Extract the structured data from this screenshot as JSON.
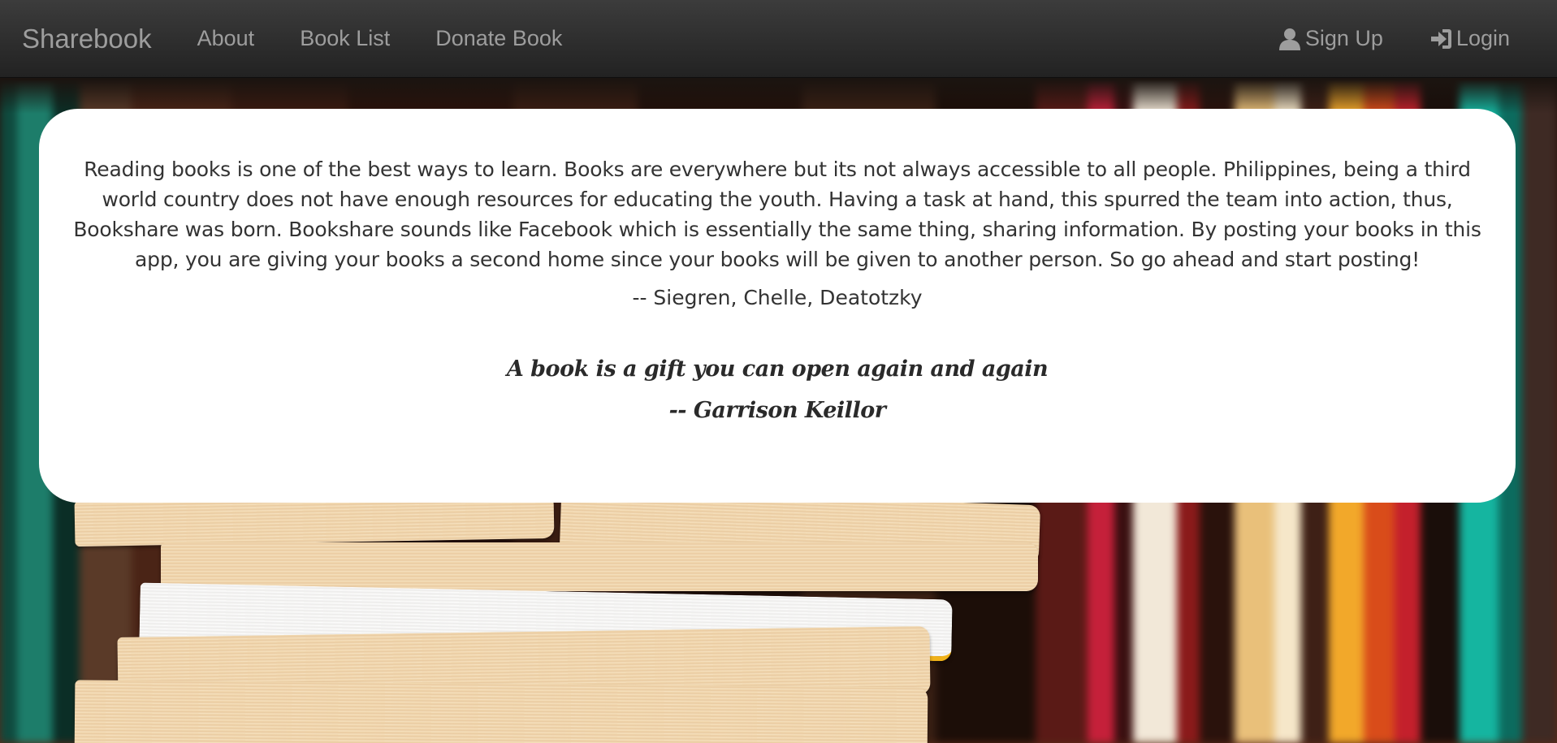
{
  "navbar": {
    "brand": "Sharebook",
    "links": [
      {
        "label": "About"
      },
      {
        "label": "Book List"
      },
      {
        "label": "Donate Book"
      }
    ],
    "right": [
      {
        "label": "Sign Up",
        "icon": "user-icon"
      },
      {
        "label": "Login",
        "icon": "login-icon"
      }
    ]
  },
  "intro": {
    "paragraph": "Reading books is one of the best ways to learn. Books are everywhere but its not always accessible to all people. Philippines, being a third world country does not have enough resources for educating the youth. Having a task at hand, this spurred the team into action, thus, Bookshare was born. Bookshare sounds like Facebook which is essentially the same thing, sharing information. By posting your books in this app, you are giving your books a second home since your books will be given to another person. So go ahead and start posting!",
    "authors": "-- Siegren, Chelle, Deatotzky"
  },
  "quote": {
    "text": "A book is a gift you can open again and again",
    "author": "-- Garrison Keillor"
  },
  "colors": {
    "navbar": "#222222",
    "nav_text": "#9d9d9d",
    "card": "#ffffff",
    "body_text": "#333333"
  }
}
